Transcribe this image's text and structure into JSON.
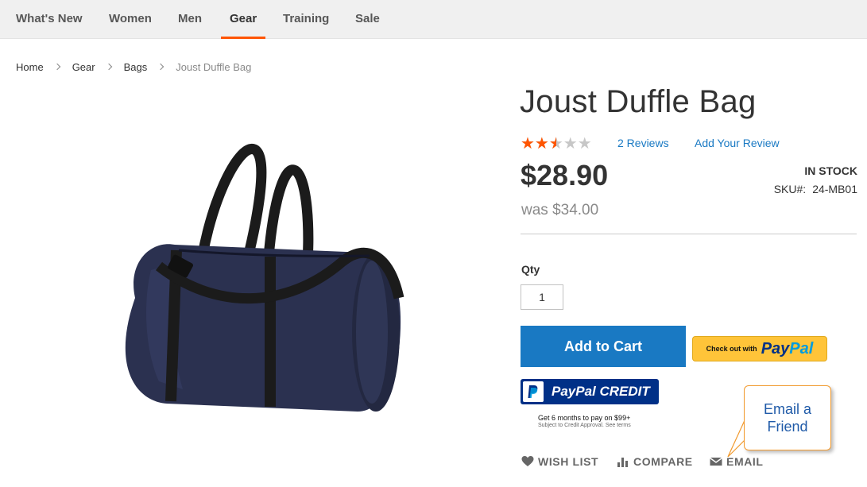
{
  "nav": {
    "items": [
      {
        "label": "What's New"
      },
      {
        "label": "Women"
      },
      {
        "label": "Men"
      },
      {
        "label": "Gear"
      },
      {
        "label": "Training"
      },
      {
        "label": "Sale"
      }
    ],
    "active": "Gear",
    "accent_color": "#ff5501"
  },
  "breadcrumb": [
    {
      "label": "Home"
    },
    {
      "label": "Gear"
    },
    {
      "label": "Bags"
    },
    {
      "label": "Joust Duffle Bag"
    }
  ],
  "product": {
    "title": "Joust Duffle Bag",
    "rating": {
      "value": 2.5,
      "max": 5,
      "star_color": "#ff5501",
      "empty_color": "#c7c7c7"
    },
    "reviews_link": "2 Reviews",
    "add_review_link": "Add Your Review",
    "price": "$28.90",
    "old_price": "was $34.00",
    "stock": "IN STOCK",
    "sku_label": "SKU#:",
    "sku_value": "24-MB01",
    "image": {
      "icon": "duffle-bag-image",
      "bag_color": "#2b3150",
      "strap_color": "#1b1b1b"
    }
  },
  "purchase": {
    "qty_label": "Qty",
    "qty_value": "1",
    "add_to_cart_label": "Add to Cart",
    "button_color": "#1979c3",
    "paypal_checkout": {
      "prefix": "Check out with",
      "pay": "Pay",
      "pal": "Pal"
    },
    "paypal_credit": {
      "label": "PayPal CREDIT",
      "terms": "Get 6 months to pay on $99+",
      "terms_sub": "Subject to Credit Approval. See terms"
    }
  },
  "actions": [
    {
      "label": "WISH LIST",
      "icon": "heart-icon"
    },
    {
      "label": "COMPARE",
      "icon": "bar-chart-icon"
    },
    {
      "label": "EMAIL",
      "icon": "envelope-icon"
    }
  ],
  "callout": {
    "line1": "Email a",
    "line2": "Friend",
    "border_color": "#f29a2e"
  }
}
